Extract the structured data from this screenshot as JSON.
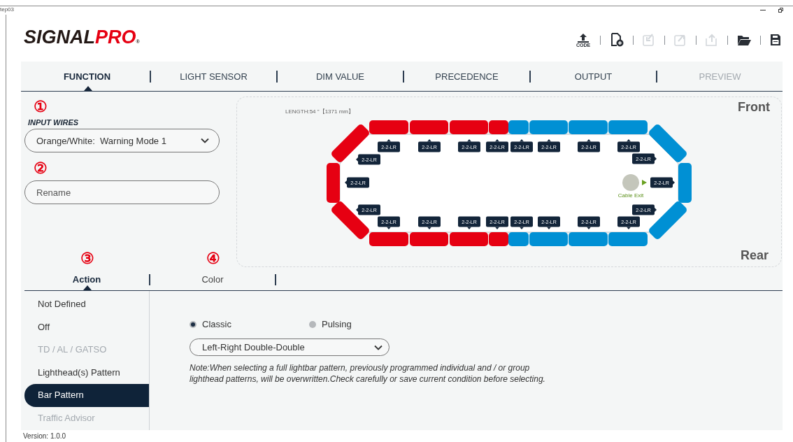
{
  "window": {
    "title": "tep03"
  },
  "logo": {
    "dark": "SIGNAL",
    "red": "PRO",
    "mark": "®"
  },
  "toolbar": [
    {
      "kind": "code-upload",
      "label": "CODE",
      "disabled": false
    },
    {
      "kind": "new-file",
      "disabled": false
    },
    {
      "kind": "import",
      "disabled": true
    },
    {
      "kind": "export",
      "disabled": true
    },
    {
      "kind": "send",
      "disabled": true
    },
    {
      "kind": "open-folder",
      "disabled": false
    },
    {
      "kind": "save",
      "disabled": false
    }
  ],
  "tabs": [
    {
      "label": "FUNCTION",
      "selected": true,
      "disabled": false
    },
    {
      "label": "LIGHT SENSOR",
      "selected": false,
      "disabled": false
    },
    {
      "label": "DIM VALUE",
      "selected": false,
      "disabled": false
    },
    {
      "label": "PRECEDENCE",
      "selected": false,
      "disabled": false
    },
    {
      "label": "OUTPUT",
      "selected": false,
      "disabled": false
    },
    {
      "label": "PREVIEW",
      "selected": false,
      "disabled": true
    }
  ],
  "input_wires": {
    "step": "①",
    "label": "INPUT WIRES",
    "value": "Orange/White:  Warning Mode 1"
  },
  "rename": {
    "step": "②",
    "placeholder": "Rename"
  },
  "lightbar": {
    "length": "LENGTH:54 \"【1371 mm】",
    "front": "Front",
    "rear": "Rear",
    "top": [
      {
        "color": "#e60012"
      },
      {
        "color": "#e60012"
      },
      {
        "color": "#e60012"
      },
      {
        "color": "#e60012"
      },
      {
        "color": "#0090d4"
      },
      {
        "color": "#0090d4"
      },
      {
        "color": "#0090d4"
      },
      {
        "color": "#0090d4"
      }
    ],
    "bottom": [
      {
        "color": "#e60012"
      },
      {
        "color": "#e60012"
      },
      {
        "color": "#e60012"
      },
      {
        "color": "#e60012"
      },
      {
        "color": "#0090d4"
      },
      {
        "color": "#0090d4"
      },
      {
        "color": "#0090d4"
      },
      {
        "color": "#0090d4"
      }
    ],
    "left_end": [
      {
        "color": "#e60012"
      },
      {
        "color": "#e60012"
      },
      {
        "color": "#e60012"
      }
    ],
    "right_end": [
      {
        "color": "#0090d4"
      },
      {
        "color": "#0090d4"
      },
      {
        "color": "#0090d4"
      }
    ],
    "top_labels": [
      "2-2-LR",
      "2-2-LR",
      "2-2-LR",
      "2-2-LR",
      "2-2-LR",
      "2-2-LR",
      "2-2-LR",
      "2-2-LR"
    ],
    "side_labels": [
      "2-2-LR",
      "2-2-LR",
      "2-2-LR",
      "2-2-LR",
      "2-2-LR",
      "2-2-LR"
    ],
    "bottom_labels": [
      "2-2-LR",
      "2-2-LR",
      "2-2-LR",
      "2-2-LR",
      "2-2-LR",
      "2-2-LR",
      "2-2-LR",
      "2-2-LR"
    ],
    "cable_exit": "Cable Exit"
  },
  "subtabs": [
    {
      "step": "③",
      "label": "Action",
      "selected": true
    },
    {
      "step": "④",
      "label": "Color",
      "selected": false
    }
  ],
  "actions": [
    {
      "label": "Not Defined",
      "selected": false,
      "disabled": false
    },
    {
      "label": "Off",
      "selected": false,
      "disabled": false
    },
    {
      "label": "TD / AL / GATSO",
      "selected": false,
      "disabled": true
    },
    {
      "label": "Lighthead(s) Pattern",
      "selected": false,
      "disabled": false
    },
    {
      "label": "Bar Pattern",
      "selected": true,
      "disabled": false
    },
    {
      "label": "Traffic Advisor",
      "selected": false,
      "disabled": true
    }
  ],
  "pattern_types": [
    {
      "label": "Classic",
      "selected": true
    },
    {
      "label": "Pulsing",
      "selected": false
    }
  ],
  "pattern": {
    "value": "Left-Right Double-Double"
  },
  "note": "Note:When selecting a full lightbar pattern, previously programmed individual and / or group lighthead patterns, will be overwritten.Check carefully or save current condition before selecting.",
  "version": "Version: 1.0.0"
}
